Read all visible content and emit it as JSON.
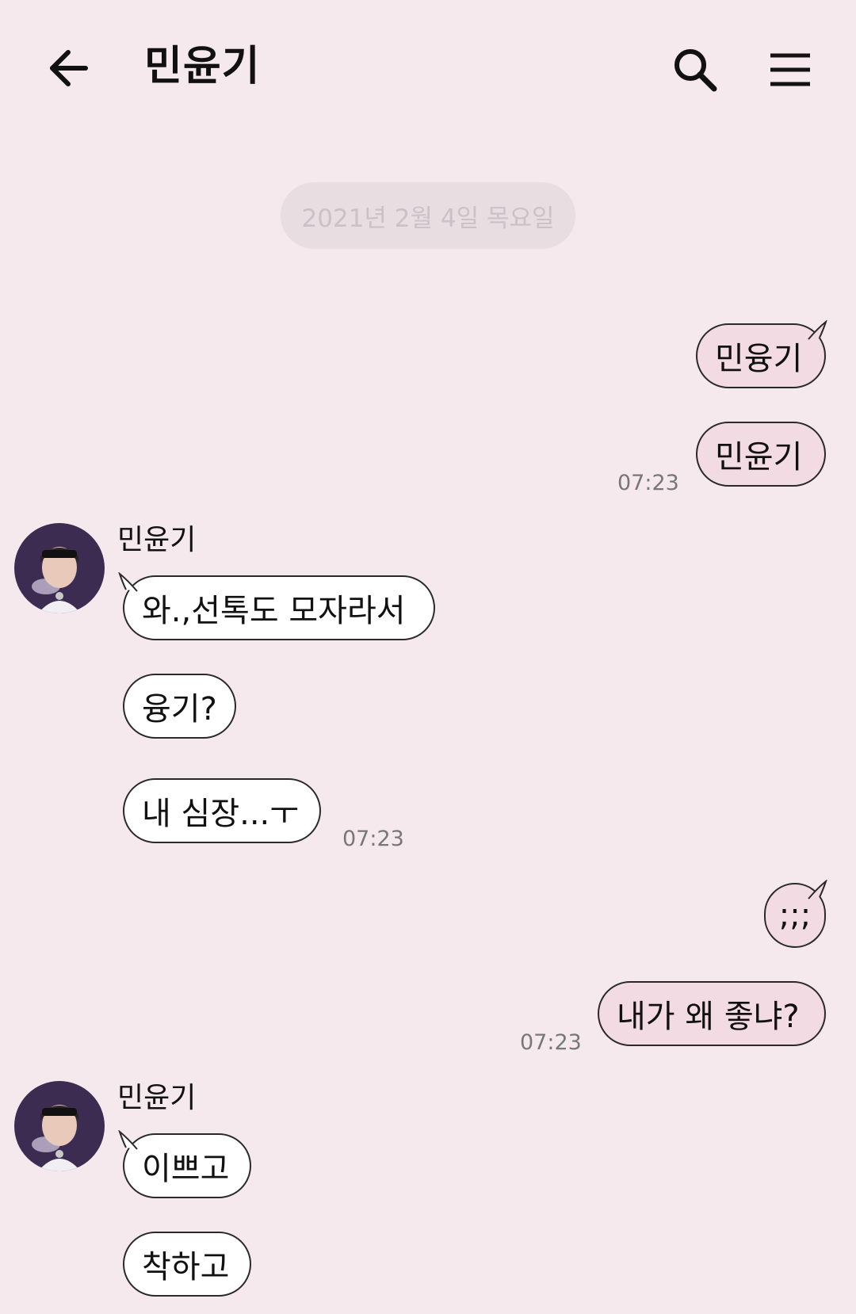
{
  "header": {
    "title": "민윤기",
    "back_icon": "arrow-left-icon",
    "search_icon": "search-icon",
    "menu_icon": "hamburger-menu-icon"
  },
  "date_divider": "2021년 2월 4일 목요일",
  "colors": {
    "background": "#f5e9ee",
    "my_bubble": "#f2dbe2",
    "their_bubble": "#ffffff"
  },
  "messages": [
    {
      "side": "me",
      "text": "민융기"
    },
    {
      "side": "me",
      "text": "민윤기",
      "time": "07:23"
    },
    {
      "side": "them",
      "sender": "민윤기",
      "text": "와.,선톡도 모자라서"
    },
    {
      "side": "them",
      "text": "융기?"
    },
    {
      "side": "them",
      "text": "내 심장...ㅜ",
      "time": "07:23"
    },
    {
      "side": "me",
      "text": ";;;"
    },
    {
      "side": "me",
      "text": "내가 왜 좋냐?",
      "time": "07:23"
    },
    {
      "side": "them",
      "sender": "민윤기",
      "text": "이쁘고"
    },
    {
      "side": "them",
      "text": "착하고"
    }
  ]
}
